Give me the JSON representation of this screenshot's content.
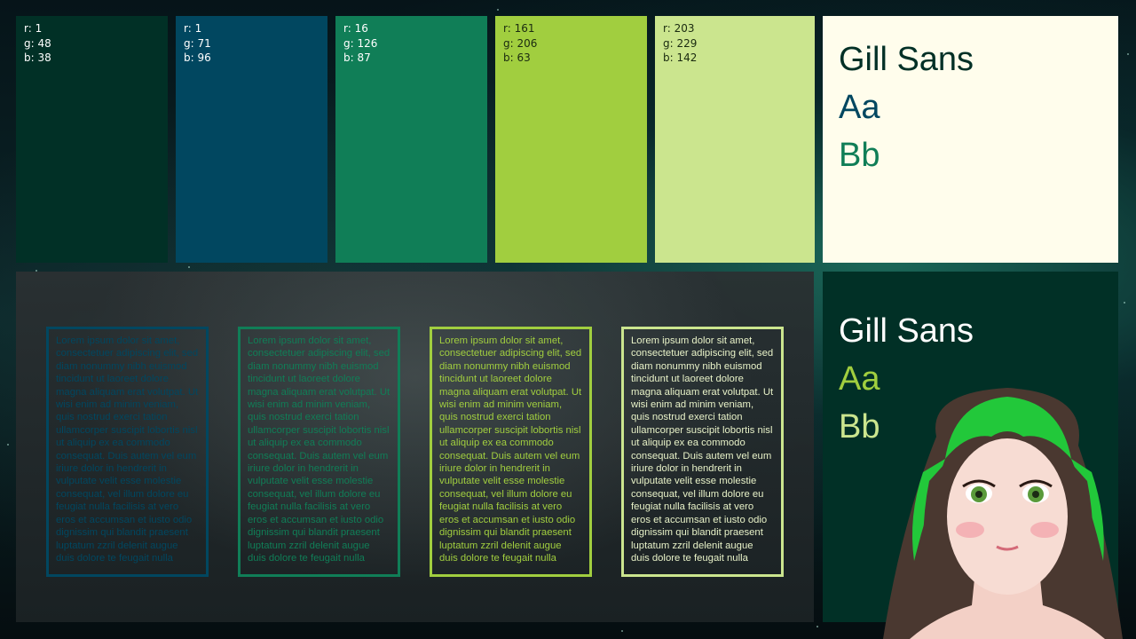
{
  "swatches": [
    {
      "r": "r: 1",
      "g": "g: 48",
      "b": "b: 38",
      "color": "#013026",
      "text_color": "#ffffff"
    },
    {
      "r": "r: 1",
      "g": "g: 71",
      "b": "b: 96",
      "color": "#014760",
      "text_color": "#ffffff"
    },
    {
      "r": "r: 16",
      "g": "g: 126",
      "b": "b: 87",
      "color": "#107e57",
      "text_color": "#ffffff"
    },
    {
      "r": "r: 161",
      "g": "g: 206",
      "b": "b: 63",
      "color": "#a1ce3f",
      "text_color": "#1a2a10"
    },
    {
      "r": "r: 203",
      "g": "g: 229",
      "b": "b: 142",
      "color": "#cbe58e",
      "text_color": "#1a2a10"
    }
  ],
  "type_light": {
    "font": "Gill Sans",
    "sample1": "Aa",
    "sample2": "Bb",
    "bg": "#fffdec"
  },
  "type_dark": {
    "font": "Gill Sans",
    "sample1": "Aa",
    "sample2": "Bb",
    "bg": "#013026"
  },
  "lorem": "Lorem ipsum dolor sit amet, consectetuer adipiscing elit, sed diam nonummy nibh euismod tincidunt ut laoreet dolore magna aliquam erat volutpat. Ut wisi enim ad minim veniam, quis nostrud exerci tation ullamcorper suscipit lobortis nisl ut aliquip ex ea commodo consequat. Duis autem vel eum iriure dolor in hendrerit in vulputate velit esse molestie consequat, vel illum dolore eu feugiat nulla facilisis at vero eros et accumsan et iusto odio dignissim qui blandit praesent luptatum zzril delenit augue duis dolore te feugait nulla",
  "lorem_colors": [
    "#014760",
    "#107e57",
    "#a1ce3f",
    "#cbe58e"
  ]
}
